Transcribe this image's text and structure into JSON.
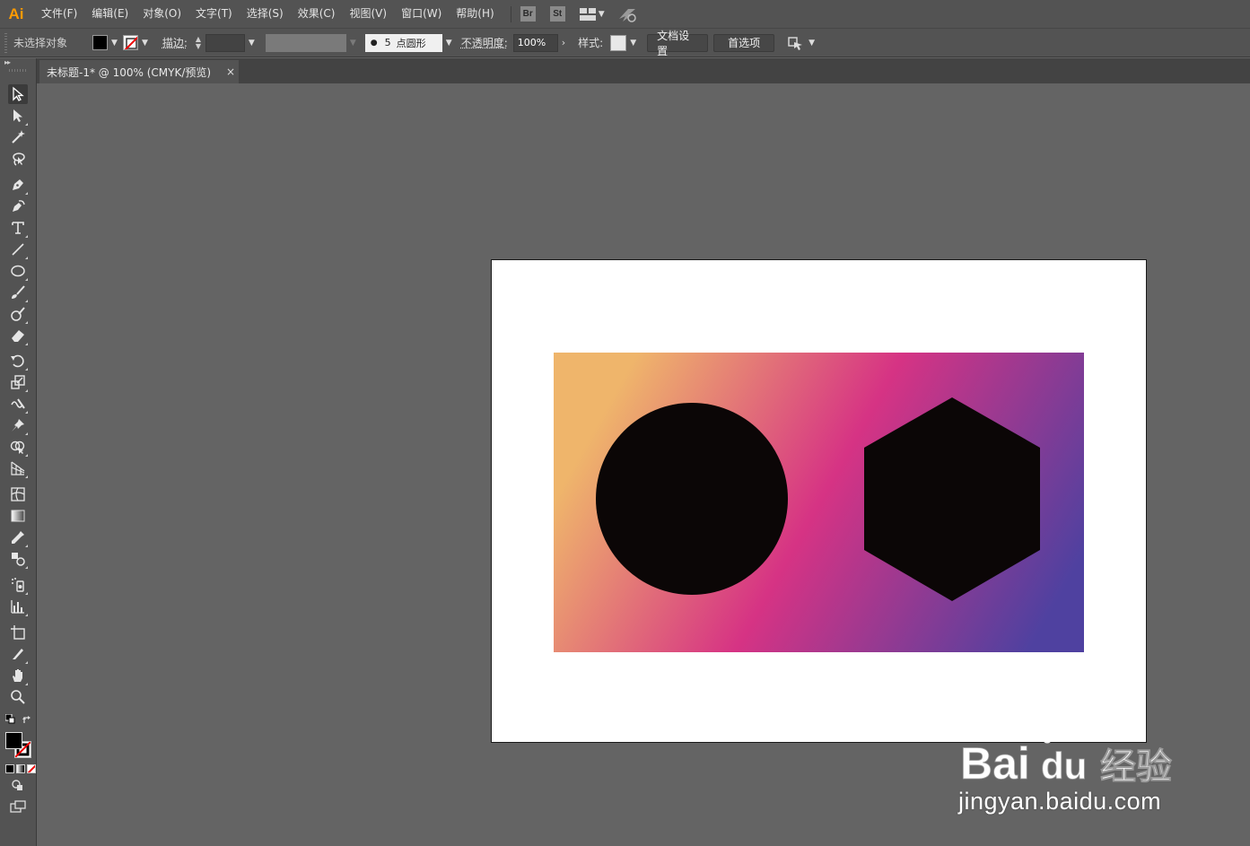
{
  "app": {
    "logo": "Ai",
    "menu": [
      "文件(F)",
      "编辑(E)",
      "对象(O)",
      "文字(T)",
      "选择(S)",
      "效果(C)",
      "视图(V)",
      "窗口(W)",
      "帮助(H)"
    ],
    "bridge_label": "Br",
    "stock_label": "St"
  },
  "control_bar": {
    "selection_status": "未选择对象",
    "fill_color": "#000000",
    "stroke_label": "描边",
    "stroke_colon": ":",
    "brush_size": "5",
    "brush_name": "点圆形",
    "opacity_label": "不透明度",
    "opacity_colon": ":",
    "opacity_value": "100%",
    "style_label": "样式",
    "style_colon": ":",
    "doc_setup_button": "文档设置",
    "preferences_button": "首选项"
  },
  "document": {
    "tab_title": "未标题-1* @ 100% (CMYK/预览)",
    "close_glyph": "×"
  },
  "artwork": {
    "gradient_colors": [
      "#efb56b",
      "#d63384",
      "#4f41a0"
    ],
    "shape_color": "#0b0606",
    "shapes": [
      "circle",
      "hexagon"
    ]
  },
  "tools": [
    "selection-tool",
    "direct-selection-tool",
    "magic-wand-tool",
    "lasso-tool",
    "pen-tool",
    "curvature-tool",
    "type-tool",
    "line-segment-tool",
    "ellipse-tool",
    "paintbrush-tool",
    "shaper-tool",
    "eraser-tool",
    "rotate-tool",
    "scale-tool",
    "warp-tool",
    "puppet-warp-tool",
    "shape-builder-tool",
    "perspective-grid-tool",
    "mesh-tool",
    "gradient-tool",
    "eyedropper-tool",
    "blend-tool",
    "symbol-sprayer-tool",
    "column-graph-tool",
    "artboard-tool",
    "slice-tool",
    "hand-tool",
    "zoom-tool"
  ],
  "watermark": {
    "brand_text": "Bai",
    "brand_text_2": "du",
    "brand_cn": "经验",
    "url": "jingyan.baidu.com"
  }
}
